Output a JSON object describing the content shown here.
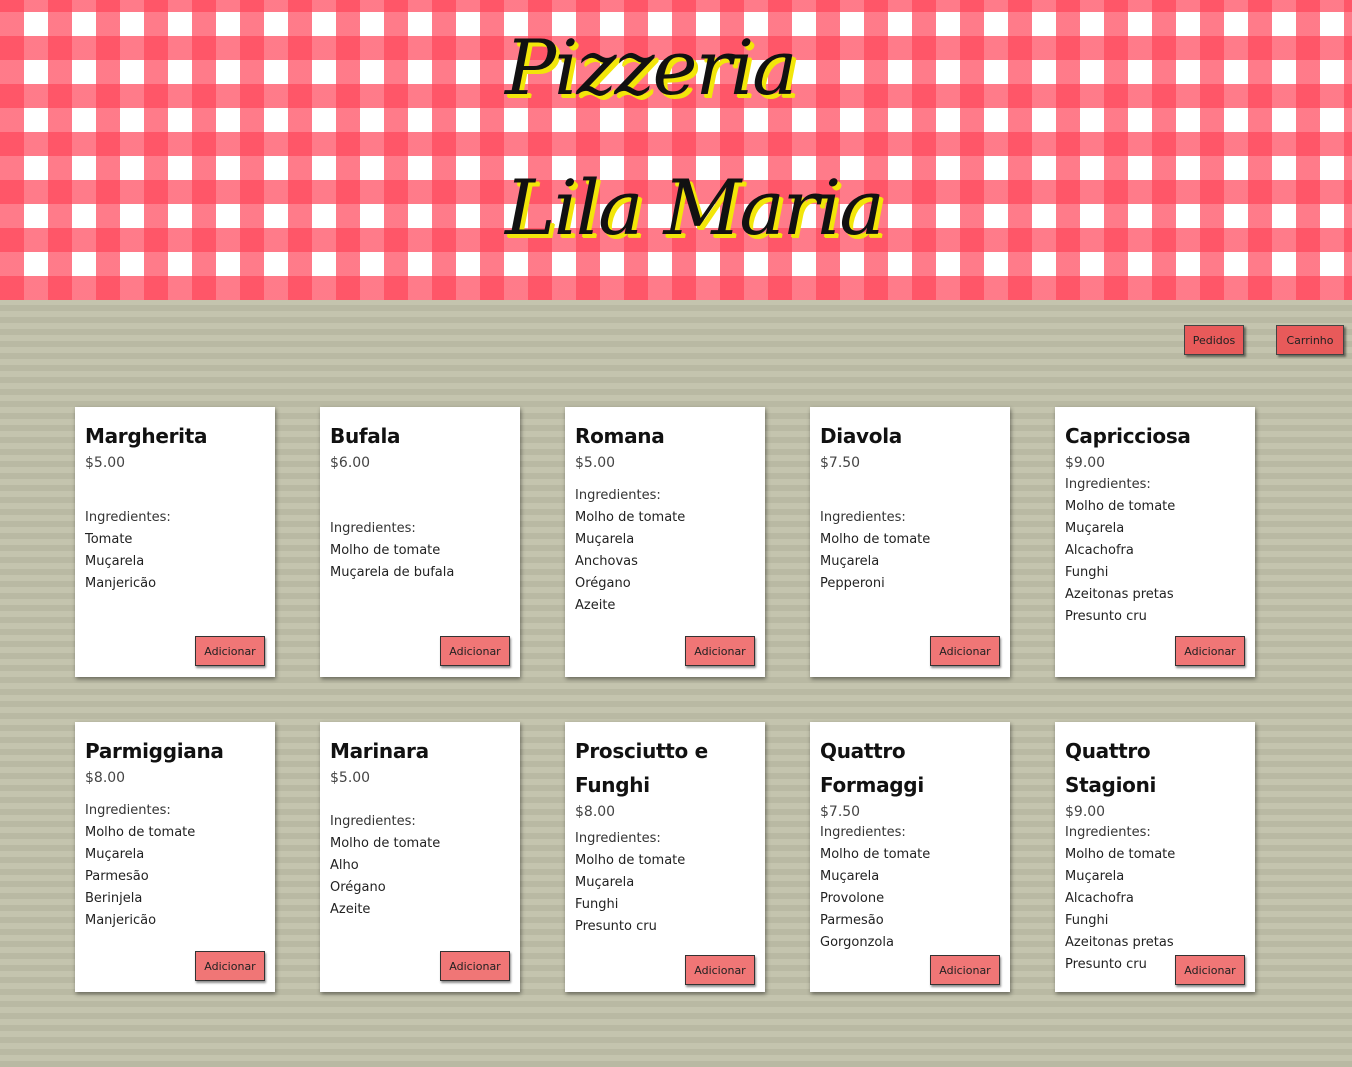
{
  "header": {
    "title_line1": "Pizzeria",
    "title_line2": "Lila Maria"
  },
  "nav": {
    "orders_label": "Pedidos",
    "cart_label": "Carrinho"
  },
  "ingredients_label": "Ingredientes:",
  "add_label": "Adicionar",
  "pizzas": [
    {
      "name": "Margherita",
      "price": "$5.00",
      "ingredients": [
        "Tomate",
        "Muçarela",
        "Manjericão"
      ]
    },
    {
      "name": "Bufala",
      "price": "$6.00",
      "ingredients": [
        "Molho de tomate",
        "Muçarela de bufala"
      ]
    },
    {
      "name": "Romana",
      "price": "$5.00",
      "ingredients": [
        "Molho de tomate",
        "Muçarela",
        "Anchovas",
        "Orégano",
        "Azeite"
      ]
    },
    {
      "name": "Diavola",
      "price": "$7.50",
      "ingredients": [
        "Molho de tomate",
        "Muçarela",
        "Pepperoni"
      ]
    },
    {
      "name": "Capricciosa",
      "price": "$9.00",
      "ingredients": [
        "Molho de tomate",
        "Muçarela",
        "Alcachofra",
        "Funghi",
        "Azeitonas pretas",
        "Presunto cru"
      ]
    },
    {
      "name": "Parmiggiana",
      "price": "$8.00",
      "ingredients": [
        "Molho de tomate",
        "Muçarela",
        "Parmesão",
        "Berinjela",
        "Manjericão"
      ]
    },
    {
      "name": "Marinara",
      "price": "$5.00",
      "ingredients": [
        "Molho de tomate",
        "Alho",
        "Orégano",
        "Azeite"
      ]
    },
    {
      "name": "Prosciutto e Funghi",
      "price": "$8.00",
      "ingredients": [
        "Molho de tomate",
        "Muçarela",
        "Funghi",
        "Presunto cru"
      ]
    },
    {
      "name": "Quattro Formaggi",
      "price": "$7.50",
      "ingredients": [
        "Molho de tomate",
        "Muçarela",
        "Provolone",
        "Parmesão",
        "Gorgonzola"
      ]
    },
    {
      "name": "Quattro Stagioni",
      "price": "$9.00",
      "ingredients": [
        "Molho de tomate",
        "Muçarela",
        "Alcachofra",
        "Funghi",
        "Azeitonas pretas",
        "Presunto cru"
      ]
    }
  ],
  "colors": {
    "button_fill": "#f07676",
    "nav_button_fill": "#e85a5a",
    "checker_red": "#ff485c",
    "title_shadow": "#f2e60a",
    "background": "#bdbda7"
  }
}
